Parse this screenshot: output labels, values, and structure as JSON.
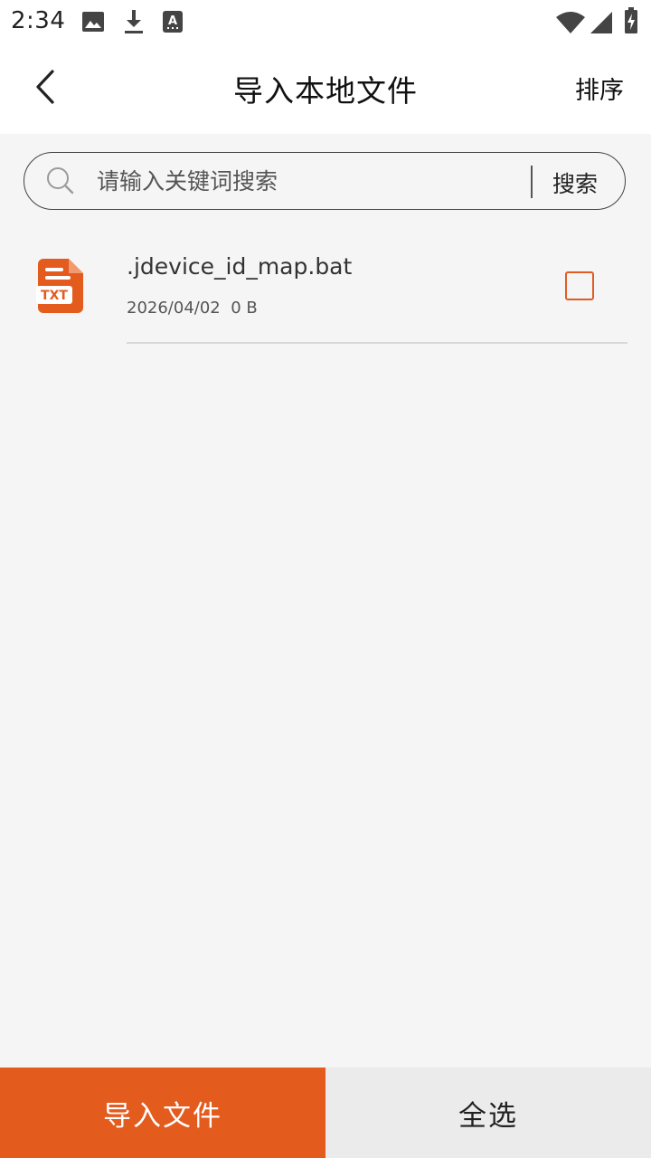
{
  "status_bar": {
    "time": "2:34",
    "left_icons": [
      "image-icon",
      "download-icon",
      "font-a-icon"
    ],
    "right_icons": [
      "wifi-icon",
      "cellular-signal-icon",
      "battery-charging-icon"
    ]
  },
  "app_bar": {
    "title": "导入本地文件",
    "sort_label": "排序",
    "back_icon": "chevron-left-icon"
  },
  "search": {
    "placeholder": "请输入关键词搜索",
    "value": "",
    "button_label": "搜索"
  },
  "files": [
    {
      "icon": "txt-file-icon",
      "icon_text": "TXT",
      "name": ".jdevice_id_map.bat",
      "date": "2026/04/02",
      "size": "0 B",
      "meta": "2026/04/02  0 B",
      "checked": false
    }
  ],
  "bottom": {
    "import_label": "导入文件",
    "select_all_label": "全选"
  },
  "colors": {
    "accent": "#e45b1e",
    "background": "#f5f5f5",
    "bar_background": "#ffffff",
    "secondary_button": "#ebebeb"
  }
}
